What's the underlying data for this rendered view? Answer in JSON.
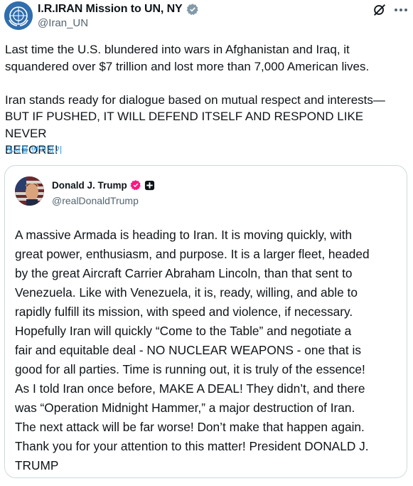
{
  "post": {
    "author": {
      "display_name": "I.R.IRAN Mission to UN, NY",
      "handle": "@Iran_UN",
      "verified_badge_color": "#829aab"
    },
    "text": "Last time the U.S. blundered into wars in Afghanistan and Iraq, it\nsquandered over $7 trillion and lost more than 7,000 American lives.\n\nIran stands ready for dialogue based on mutual respect and interests—\nBUT IF PUSHED, IT WILL DEFEND ITSELF AND RESPOND LIKE NEVER\nBEFORE!",
    "translate_link": "게시물 번역하기",
    "icons": [
      "grok-icon",
      "more-options-icon"
    ]
  },
  "quoted_post": {
    "author": {
      "display_name": "Donald J. Trump",
      "handle": "@realDonaldTrump",
      "verified_badge_color": "#f91880"
    },
    "text": "A massive Armada is heading to Iran. It is moving quickly, with\ngreat power, enthusiasm, and purpose. It is a larger fleet, headed\nby the great Aircraft Carrier Abraham Lincoln, than that sent to\nVenezuela. Like with Venezuela, it is, ready, willing, and able to\nrapidly fulfill its mission, with speed and violence, if necessary.\nHopefully Iran will quickly “Come to the Table” and negotiate a\nfair and equitable deal - NO NUCLEAR WEAPONS - one that is\ngood for all parties. Time is running out, it is truly of the essence!\nAs I told Iran once before, MAKE A DEAL! They didn’t, and there\nwas “Operation Midnight Hammer,” a major destruction of Iran.\nThe next attack will be far worse! Don’t make that happen again.\nThank you for your attention to this matter!  President DONALD J.\nTRUMP"
  },
  "colors": {
    "text_primary": "#0f1419",
    "text_secondary": "#536471",
    "link": "#1d9bf0",
    "border": "#cfd9de"
  }
}
